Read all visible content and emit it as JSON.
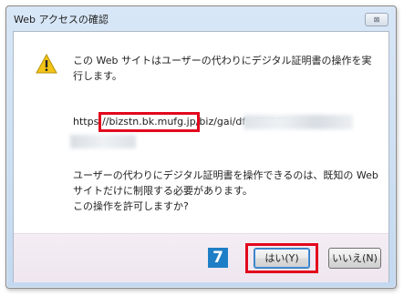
{
  "window": {
    "title": "Web アクセスの確認",
    "close_glyph": "⊠"
  },
  "message": {
    "line1": "この Web サイトはユーザーの代わりにデジタル証明書の操作を実行します。",
    "url_prefix": "https:",
    "url_highlight": "//bizstn.bk.mufg.jp",
    "url_rest": "/biz/gai/dfw/CERT/",
    "line2": "ユーザーの代わりにデジタル証明書を操作できるのは、既知の Web サイトだけに制限する必要があります。",
    "line3": "この操作を許可しますか?"
  },
  "buttons": {
    "yes_label": "はい(Y)",
    "no_label": "いいえ(N)"
  },
  "annotation": {
    "step_number": "7"
  },
  "colors": {
    "highlight": "#e3071d",
    "step_badge": "#1f7fc6",
    "warning_icon": "#f2c417"
  },
  "icons": {
    "warning": "warning-icon",
    "close": "close-icon"
  }
}
